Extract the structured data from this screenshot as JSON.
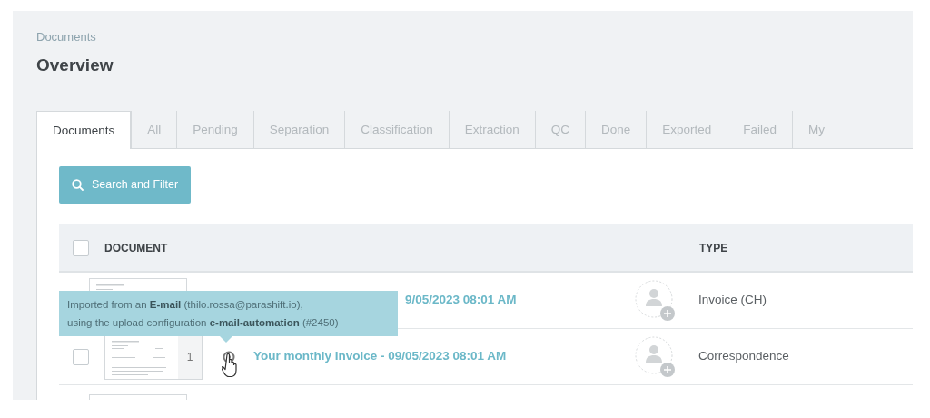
{
  "breadcrumb": "Documents",
  "title": "Overview",
  "tabs": [
    {
      "label": "Documents",
      "selected": true
    },
    {
      "label": "All",
      "selected": false
    },
    {
      "label": "Pending",
      "selected": false
    },
    {
      "label": "Separation",
      "selected": false
    },
    {
      "label": "Classification",
      "selected": false
    },
    {
      "label": "Extraction",
      "selected": false
    },
    {
      "label": "QC",
      "selected": false
    },
    {
      "label": "Done",
      "selected": false
    },
    {
      "label": "Exported",
      "selected": false
    },
    {
      "label": "Failed",
      "selected": false
    },
    {
      "label": "My",
      "selected": false
    }
  ],
  "search_button": "Search and Filter",
  "table": {
    "header_checked": false,
    "columns": [
      "DOCUMENT",
      "TYPE"
    ],
    "rows": [
      {
        "kind": "covered",
        "title": "9/05/2023 08:01 AM",
        "type": "Invoice (CH)"
      },
      {
        "kind": "full",
        "checked": false,
        "pages": "1",
        "source": {
          "kind": "target"
        },
        "title": "Your monthly Invoice - 09/05/2023 08:01 AM",
        "type": "Correspondence"
      },
      {
        "kind": "partial"
      }
    ]
  },
  "tooltip": {
    "lines": [
      "Imported from an **E-mail** (thilo.rossa@parashift.io),",
      "using the upload configuration **e-mail-automation** (#2450)"
    ]
  }
}
